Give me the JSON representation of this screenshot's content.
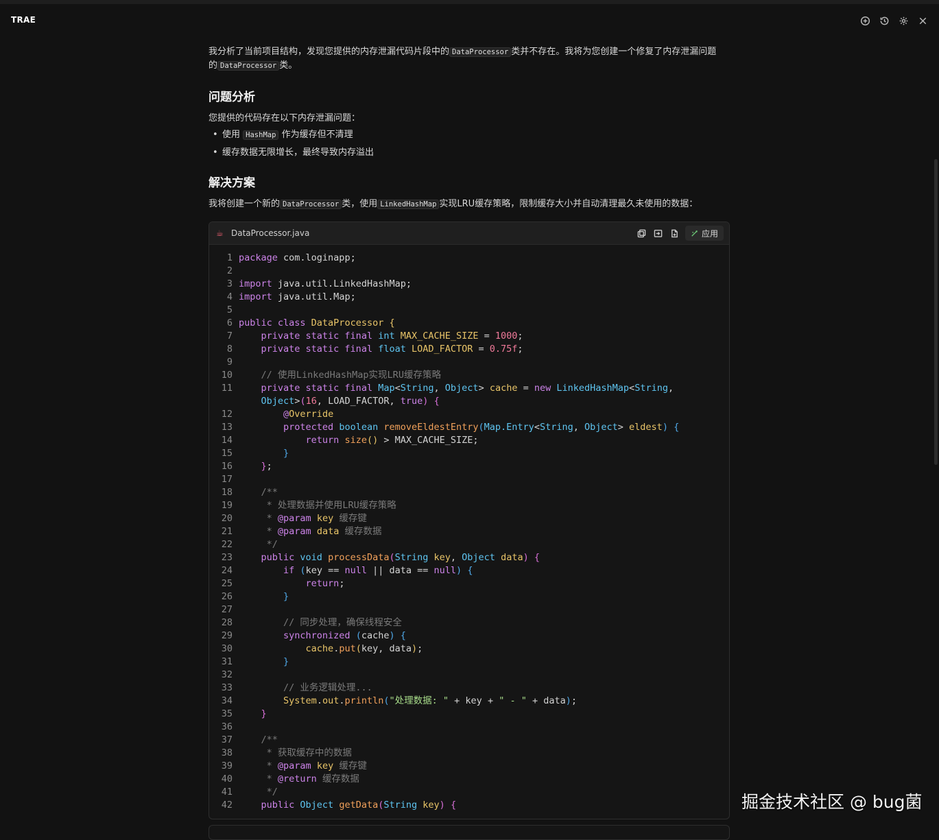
{
  "app": {
    "title": "TRAE"
  },
  "titlebar": {
    "icons": [
      "add-chat-icon",
      "history-icon",
      "settings-icon",
      "close-icon"
    ]
  },
  "message": {
    "intro_1": "我分析了当前项目结构，发现您提供的内存泄漏代码片段中的",
    "intro_code_1": "DataProcessor",
    "intro_2": "类并不存在。我将为您创建一个修复了内存泄漏问题",
    "intro_3": "的",
    "intro_code_2": "DataProcessor",
    "intro_4": "类。",
    "heading_analysis": "问题分析",
    "analysis_lead": "您提供的代码存在以下内存泄漏问题：",
    "bullet_1_pre": "使用",
    "bullet_1_code": "HashMap",
    "bullet_1_post": "作为缓存但不清理",
    "bullet_2": "缓存数据无限增长，最终导致内存溢出",
    "heading_solution": "解决方案",
    "solution_1": "我将创建一个新的",
    "solution_code_1": "DataProcessor",
    "solution_2": "类，使用",
    "solution_code_2": "LinkedHashMap",
    "solution_3": "实现LRU缓存策略，限制缓存大小并自动清理最久未使用的数据："
  },
  "code_block": {
    "file_name": "DataProcessor.java",
    "apply_label": "应用",
    "lines": [
      {
        "n": "1",
        "t": [
          [
            "kw",
            "package"
          ],
          [
            "p",
            " com.loginapp;"
          ]
        ]
      },
      {
        "n": "2",
        "t": []
      },
      {
        "n": "3",
        "t": [
          [
            "kw",
            "import"
          ],
          [
            "p",
            " java.util.LinkedHashMap;"
          ]
        ]
      },
      {
        "n": "4",
        "t": [
          [
            "kw",
            "import"
          ],
          [
            "p",
            " java.util.Map;"
          ]
        ]
      },
      {
        "n": "5",
        "t": []
      },
      {
        "n": "6",
        "t": [
          [
            "kw",
            "public class "
          ],
          [
            "cls",
            "DataProcessor "
          ],
          [
            "br1",
            "{"
          ]
        ]
      },
      {
        "n": "7",
        "t": [
          [
            "p",
            "    "
          ],
          [
            "kw",
            "private static final "
          ],
          [
            "ty",
            "int "
          ],
          [
            "var",
            "MAX_CACHE_SIZE"
          ],
          [
            "p",
            " = "
          ],
          [
            "num",
            "1000"
          ],
          [
            "p",
            ";"
          ]
        ]
      },
      {
        "n": "8",
        "t": [
          [
            "p",
            "    "
          ],
          [
            "kw",
            "private static final "
          ],
          [
            "ty",
            "float "
          ],
          [
            "var",
            "LOAD_FACTOR"
          ],
          [
            "p",
            " = "
          ],
          [
            "num",
            "0.75f"
          ],
          [
            "p",
            ";"
          ]
        ]
      },
      {
        "n": "9",
        "t": []
      },
      {
        "n": "10",
        "t": [
          [
            "p",
            "    "
          ],
          [
            "cm",
            "// 使用LinkedHashMap实现LRU缓存策略"
          ]
        ]
      },
      {
        "n": "11",
        "t": [
          [
            "p",
            "    "
          ],
          [
            "kw",
            "private static final "
          ],
          [
            "ty",
            "Map"
          ],
          [
            "p",
            "<"
          ],
          [
            "ty",
            "String"
          ],
          [
            "p",
            ", "
          ],
          [
            "ty",
            "Object"
          ],
          [
            "p",
            "> "
          ],
          [
            "var",
            "cache"
          ],
          [
            "p",
            " = "
          ],
          [
            "kw",
            "new "
          ],
          [
            "ty",
            "LinkedHashMap"
          ],
          [
            "p",
            "<"
          ],
          [
            "ty",
            "String"
          ],
          [
            "p",
            ","
          ]
        ]
      },
      {
        "n": "",
        "t": [
          [
            "p",
            "    "
          ],
          [
            "ty",
            "Object"
          ],
          [
            "p",
            ">"
          ],
          [
            "br2",
            "("
          ],
          [
            "num",
            "16"
          ],
          [
            "p",
            ", LOAD_FACTOR, "
          ],
          [
            "kw",
            "true"
          ],
          [
            "br2",
            ")"
          ],
          [
            "p",
            " "
          ],
          [
            "br2",
            "{"
          ]
        ]
      },
      {
        "n": "12",
        "t": [
          [
            "p",
            "        "
          ],
          [
            "an",
            "@"
          ],
          [
            "var",
            "Override"
          ]
        ]
      },
      {
        "n": "13",
        "t": [
          [
            "p",
            "        "
          ],
          [
            "kw",
            "protected "
          ],
          [
            "ty",
            "boolean "
          ],
          [
            "fn",
            "removeEldestEntry"
          ],
          [
            "br3",
            "("
          ],
          [
            "ty",
            "Map.Entry"
          ],
          [
            "p",
            "<"
          ],
          [
            "ty",
            "String"
          ],
          [
            "p",
            ", "
          ],
          [
            "ty",
            "Object"
          ],
          [
            "p",
            "> "
          ],
          [
            "var",
            "eldest"
          ],
          [
            "br3",
            ")"
          ],
          [
            "p",
            " "
          ],
          [
            "br3",
            "{"
          ]
        ]
      },
      {
        "n": "14",
        "t": [
          [
            "p",
            "            "
          ],
          [
            "kw",
            "return "
          ],
          [
            "fn",
            "size"
          ],
          [
            "br1",
            "()"
          ],
          [
            "p",
            " > MAX_CACHE_SIZE;"
          ]
        ]
      },
      {
        "n": "15",
        "t": [
          [
            "p",
            "        "
          ],
          [
            "br3",
            "}"
          ]
        ]
      },
      {
        "n": "16",
        "t": [
          [
            "p",
            "    "
          ],
          [
            "br2",
            "}"
          ],
          [
            "p",
            ";"
          ]
        ]
      },
      {
        "n": "17",
        "t": []
      },
      {
        "n": "18",
        "t": [
          [
            "p",
            "    "
          ],
          [
            "cm",
            "/**"
          ]
        ]
      },
      {
        "n": "19",
        "t": [
          [
            "p",
            "     "
          ],
          [
            "cm",
            "* 处理数据并使用LRU缓存策略"
          ]
        ]
      },
      {
        "n": "20",
        "t": [
          [
            "p",
            "     "
          ],
          [
            "cm",
            "* "
          ],
          [
            "an",
            "@param "
          ],
          [
            "var",
            "key "
          ],
          [
            "cm",
            "缓存键"
          ]
        ]
      },
      {
        "n": "21",
        "t": [
          [
            "p",
            "     "
          ],
          [
            "cm",
            "* "
          ],
          [
            "an",
            "@param "
          ],
          [
            "var",
            "data "
          ],
          [
            "cm",
            "缓存数据"
          ]
        ]
      },
      {
        "n": "22",
        "t": [
          [
            "p",
            "     "
          ],
          [
            "cm",
            "*/"
          ]
        ]
      },
      {
        "n": "23",
        "t": [
          [
            "p",
            "    "
          ],
          [
            "kw",
            "public "
          ],
          [
            "ty",
            "void "
          ],
          [
            "fn",
            "processData"
          ],
          [
            "br2",
            "("
          ],
          [
            "ty",
            "String "
          ],
          [
            "var",
            "key"
          ],
          [
            "p",
            ", "
          ],
          [
            "ty",
            "Object "
          ],
          [
            "var",
            "data"
          ],
          [
            "br2",
            ")"
          ],
          [
            "p",
            " "
          ],
          [
            "br2",
            "{"
          ]
        ]
      },
      {
        "n": "24",
        "t": [
          [
            "p",
            "        "
          ],
          [
            "kw",
            "if "
          ],
          [
            "br3",
            "("
          ],
          [
            "p",
            "key == "
          ],
          [
            "kw",
            "null"
          ],
          [
            "p",
            " || data == "
          ],
          [
            "kw",
            "null"
          ],
          [
            "br3",
            ")"
          ],
          [
            "p",
            " "
          ],
          [
            "br3",
            "{"
          ]
        ]
      },
      {
        "n": "25",
        "t": [
          [
            "p",
            "            "
          ],
          [
            "kw",
            "return"
          ],
          [
            "p",
            ";"
          ]
        ]
      },
      {
        "n": "26",
        "t": [
          [
            "p",
            "        "
          ],
          [
            "br3",
            "}"
          ]
        ]
      },
      {
        "n": "27",
        "t": []
      },
      {
        "n": "28",
        "t": [
          [
            "p",
            "        "
          ],
          [
            "cm",
            "// 同步处理，确保线程安全"
          ]
        ]
      },
      {
        "n": "29",
        "t": [
          [
            "p",
            "        "
          ],
          [
            "kw",
            "synchronized "
          ],
          [
            "br3",
            "("
          ],
          [
            "p",
            "cache"
          ],
          [
            "br3",
            ")"
          ],
          [
            "p",
            " "
          ],
          [
            "br3",
            "{"
          ]
        ]
      },
      {
        "n": "30",
        "t": [
          [
            "p",
            "            "
          ],
          [
            "var",
            "cache"
          ],
          [
            "p",
            "."
          ],
          [
            "fn",
            "put"
          ],
          [
            "br1",
            "("
          ],
          [
            "p",
            "key, data"
          ],
          [
            "br1",
            ")"
          ],
          [
            "p",
            ";"
          ]
        ]
      },
      {
        "n": "31",
        "t": [
          [
            "p",
            "        "
          ],
          [
            "br3",
            "}"
          ]
        ]
      },
      {
        "n": "32",
        "t": []
      },
      {
        "n": "33",
        "t": [
          [
            "p",
            "        "
          ],
          [
            "cm",
            "// 业务逻辑处理..."
          ]
        ]
      },
      {
        "n": "34",
        "t": [
          [
            "p",
            "        "
          ],
          [
            "var",
            "System"
          ],
          [
            "p",
            "."
          ],
          [
            "var",
            "out"
          ],
          [
            "p",
            "."
          ],
          [
            "fn",
            "println"
          ],
          [
            "br3",
            "("
          ],
          [
            "str",
            "\"处理数据: \""
          ],
          [
            "p",
            " + key + "
          ],
          [
            "str",
            "\" - \""
          ],
          [
            "p",
            " + data"
          ],
          [
            "br3",
            ")"
          ],
          [
            "p",
            ";"
          ]
        ]
      },
      {
        "n": "35",
        "t": [
          [
            "p",
            "    "
          ],
          [
            "br2",
            "}"
          ]
        ]
      },
      {
        "n": "36",
        "t": []
      },
      {
        "n": "37",
        "t": [
          [
            "p",
            "    "
          ],
          [
            "cm",
            "/**"
          ]
        ]
      },
      {
        "n": "38",
        "t": [
          [
            "p",
            "     "
          ],
          [
            "cm",
            "* 获取缓存中的数据"
          ]
        ]
      },
      {
        "n": "39",
        "t": [
          [
            "p",
            "     "
          ],
          [
            "cm",
            "* "
          ],
          [
            "an",
            "@param "
          ],
          [
            "var",
            "key "
          ],
          [
            "cm",
            "缓存键"
          ]
        ]
      },
      {
        "n": "40",
        "t": [
          [
            "p",
            "     "
          ],
          [
            "cm",
            "* "
          ],
          [
            "an",
            "@return "
          ],
          [
            "cm",
            "缓存数据"
          ]
        ]
      },
      {
        "n": "41",
        "t": [
          [
            "p",
            "     "
          ],
          [
            "cm",
            "*/"
          ]
        ]
      },
      {
        "n": "42",
        "t": [
          [
            "p",
            "    "
          ],
          [
            "kw",
            "public "
          ],
          [
            "ty",
            "Object "
          ],
          [
            "fn",
            "getData"
          ],
          [
            "br2",
            "("
          ],
          [
            "ty",
            "String "
          ],
          [
            "var",
            "key"
          ],
          [
            "br2",
            ")"
          ],
          [
            "p",
            " "
          ],
          [
            "br2",
            "{"
          ]
        ]
      }
    ]
  },
  "watermark": "掘金技术社区 @ bug菌"
}
